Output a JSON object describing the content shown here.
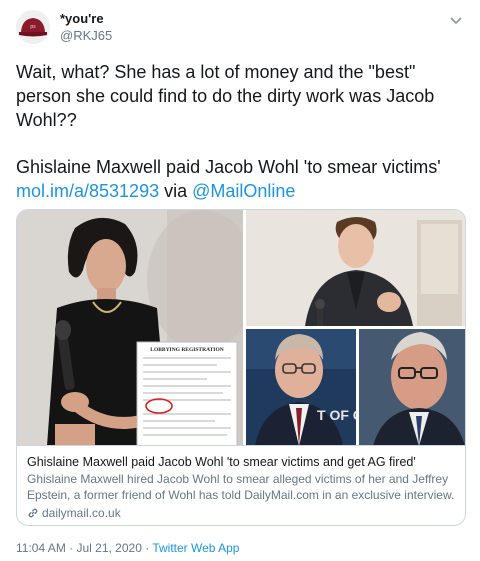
{
  "author": {
    "display_name": "*you're",
    "handle": "@RKJ65"
  },
  "tweet": {
    "text": "Wait, what?  She has a lot of money and the \"best\" person she could find to do the dirty work was Jacob Wohl??",
    "headline": "Ghislaine Maxwell paid Jacob Wohl 'to smear victims'",
    "short_link": "mol.im/a/8531293",
    "via_text": " via ",
    "mention": "@MailOnline"
  },
  "card": {
    "title": "Ghislaine Maxwell paid Jacob Wohl 'to smear victims and get AG fired'",
    "description": "Ghislaine Maxwell hired Jacob Wohl to smear alleged victims of her and Jeffrey Epstein, a former friend of Wohl has told DailyMail.com in an exclusive interview.",
    "domain": "dailymail.co.uk",
    "document_heading": "LOBBYING REGISTRATION",
    "podium_text": "T OF  CE"
  },
  "footer": {
    "time": "11:04 AM",
    "sep": " · ",
    "date": "Jul 21, 2020",
    "sep2": " · ",
    "source": "Twitter Web App"
  },
  "colors": {
    "link": "#1b95e0",
    "secondary_text": "#657786",
    "border": "#ccd6dd"
  }
}
